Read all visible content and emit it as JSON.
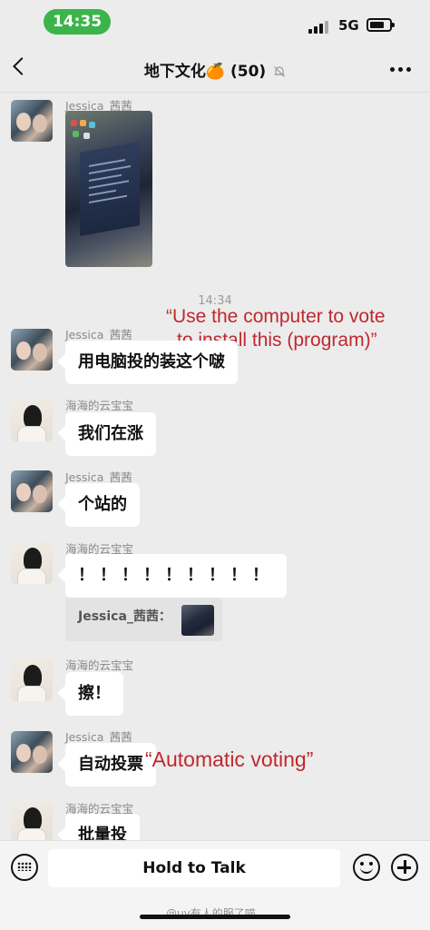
{
  "status_bar": {
    "time": "14:35",
    "network": "5G"
  },
  "header": {
    "title": "地下文化🍊",
    "member_count": "(50)"
  },
  "messages": [
    {
      "sender": "Jessica_茜茜",
      "type": "image"
    },
    {
      "sender": "Jessica_茜茜",
      "text": "用电脑投的装这个啵"
    },
    {
      "sender": "海海的云宝宝",
      "text": "我们在涨"
    },
    {
      "sender": "Jessica_茜茜",
      "text": "个站的"
    },
    {
      "sender": "海海的云宝宝",
      "text": "！！！！！！！！！",
      "quote": "Jessica_茜茜："
    },
    {
      "sender": "海海的云宝宝",
      "text": "擦！"
    },
    {
      "sender": "Jessica_茜茜",
      "text": "自动投票"
    },
    {
      "sender": "海海的云宝宝",
      "text": "批量投"
    }
  ],
  "timestamp": "14:34",
  "annotations": {
    "first": "“Use the computer to vote",
    "second": "to install this (program)”",
    "third": "“Automatic voting”"
  },
  "input_bar": {
    "hold_label": "Hold to Talk"
  },
  "watermark": "@uv有人的服了喵",
  "colors": {
    "time_pill": "#3bb54a",
    "annotation": "#c0282c",
    "background": "#ececec"
  },
  "icons": [
    "back-icon",
    "mute-bell-icon",
    "more-icon",
    "keyboard-icon",
    "emoji-icon",
    "plus-icon"
  ]
}
